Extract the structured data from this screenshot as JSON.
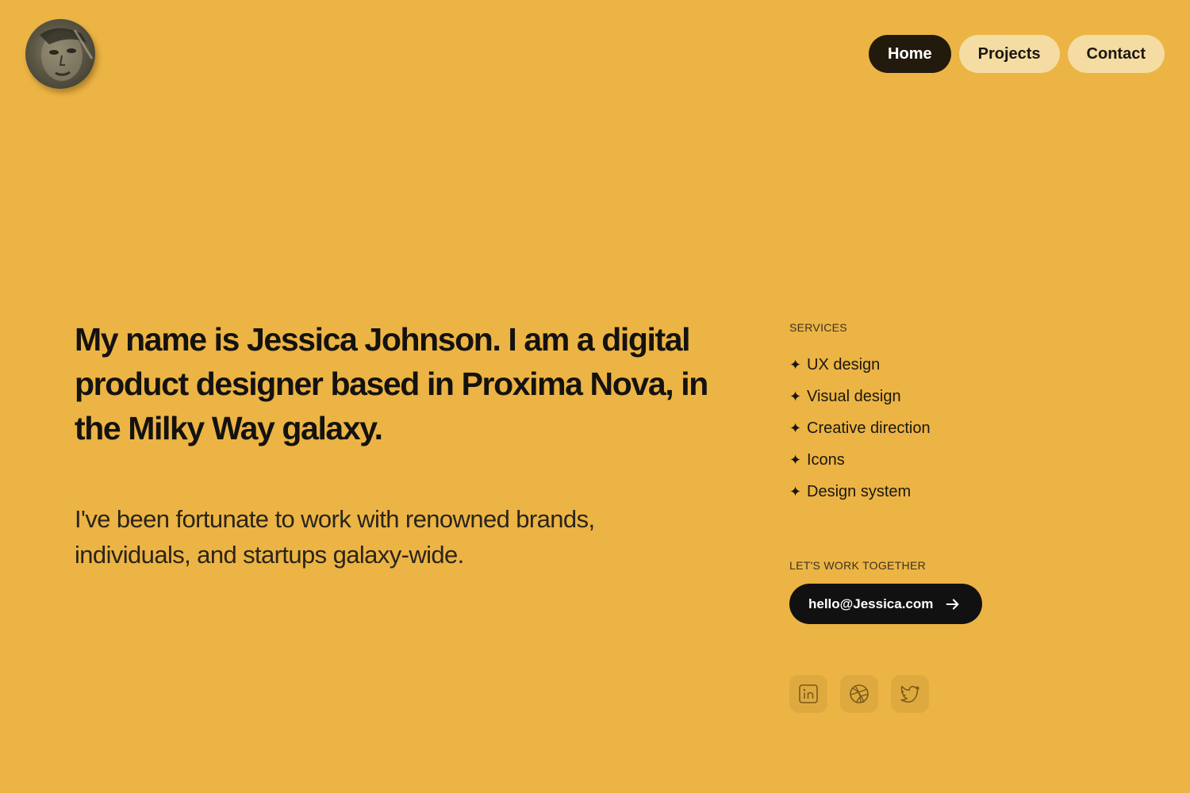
{
  "theme": {
    "background": "#ECB444",
    "nav_active_bg": "#221a0c",
    "nav_inactive_bg": "#F4DCA2",
    "email_button_bg": "#111111",
    "social_icon_bg": "#DEAA40"
  },
  "nav": {
    "items": [
      {
        "label": "Home",
        "active": true
      },
      {
        "label": "Projects",
        "active": false
      },
      {
        "label": "Contact",
        "active": false
      }
    ]
  },
  "hero": {
    "headline": "My name is Jessica Johnson. I am a digital product designer based in Proxima Nova, in the Milky Way galaxy.",
    "subhead": "I've been fortunate to work with renowned brands, individuals, and startups galaxy-wide."
  },
  "services": {
    "label": "SERVICES",
    "bullet": "✦",
    "items": [
      "UX design",
      "Visual design",
      "Creative direction",
      "Icons",
      "Design system"
    ]
  },
  "contact": {
    "label": "LET'S WORK TOGETHER",
    "email": "hello@Jessica.com",
    "arrow_icon": "arrow-right-icon"
  },
  "socials": [
    {
      "icon": "linkedin-icon"
    },
    {
      "icon": "dribbble-icon"
    },
    {
      "icon": "twitter-icon"
    }
  ]
}
